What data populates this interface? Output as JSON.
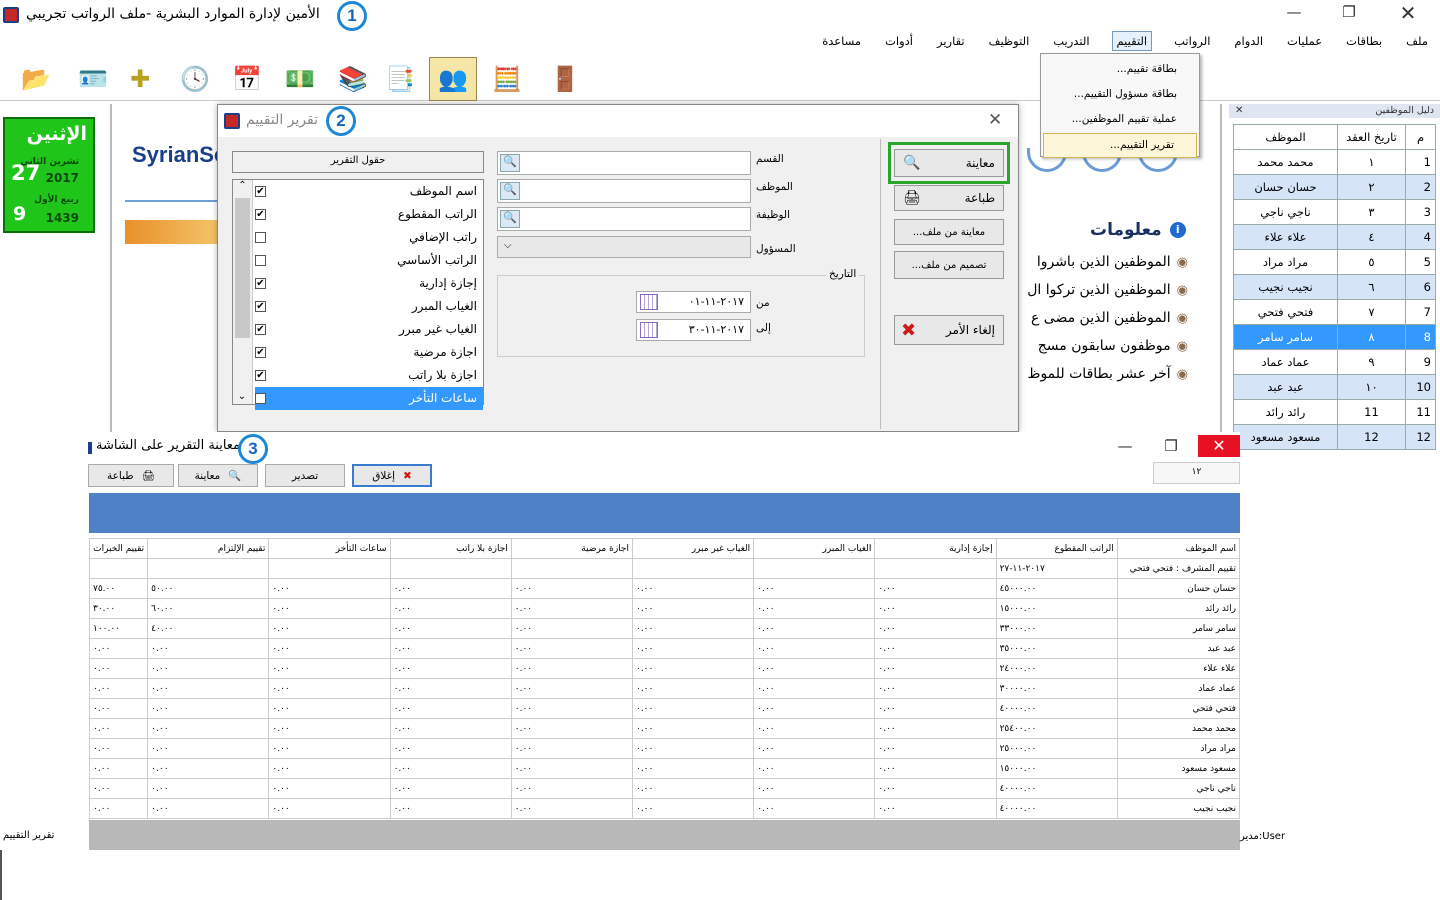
{
  "app": {
    "title": "الأمين لإدارة الموارد البشرية -ملف الرواتب تجريبي",
    "callout": "1"
  },
  "menu": [
    "ملف",
    "بطاقات",
    "عمليات",
    "الدوام",
    "الرواتب",
    "التقييم",
    "التدريب",
    "التوظيف",
    "تقارير",
    "أدوات",
    "مساعدة"
  ],
  "menu_active_index": 5,
  "dropdown": [
    "بطاقة تقييم...",
    "بطاقة مسؤول التقييم...",
    "عملية تقييم الموظفين...",
    "تقرير التقييم..."
  ],
  "date": {
    "day_name": "الإثنين",
    "greg_day": "27",
    "greg_month": "تشرين الثاني",
    "greg_year": "2017",
    "hijri_day": "9",
    "hijri_month": "ربيع الأول",
    "hijri_year": "1439"
  },
  "brand": "SyrianSo",
  "info": {
    "title": "معلومات",
    "items": [
      "الموظفين الذين باشروا",
      "الموظفين الذين تركوا ال",
      "الموظفين الذين مضى ع",
      "موظفون سابقون مسج",
      "آخر عشر بطاقات للموظ"
    ]
  },
  "emp_panel": {
    "title": "دليل الموظفين",
    "headers": [
      "م",
      "تاريخ العقد",
      "الموظف"
    ],
    "rows": [
      [
        "1",
        "١",
        "محمد محمد"
      ],
      [
        "2",
        "٢",
        "حسان حسان"
      ],
      [
        "3",
        "٣",
        "ناجي ناجي"
      ],
      [
        "4",
        "٤",
        "علاء علاء"
      ],
      [
        "5",
        "٥",
        "مراد مراد"
      ],
      [
        "6",
        "٦",
        "نجيب نجيب"
      ],
      [
        "7",
        "٧",
        "فتحي فتحي"
      ],
      [
        "8",
        "٨",
        "سامر سامر"
      ],
      [
        "9",
        "٩",
        "عماد عماد"
      ],
      [
        "10",
        "١٠",
        "عبد عبد"
      ],
      [
        "11",
        "11",
        "رائد رائد"
      ],
      [
        "12",
        "12",
        "مسعود مسعود"
      ]
    ],
    "selected_index": 7
  },
  "dialog": {
    "title": "تقرير التقييم",
    "callout": "2",
    "buttons": {
      "preview": "معاينة",
      "print": "طباعة",
      "preview_file": "معاينة من ملف...",
      "design_file": "تصميم من ملف...",
      "cancel": "إلغاء الأمر"
    },
    "labels": {
      "dept": "القسم",
      "employee": "الموظف",
      "job": "الوظيفة",
      "manager": "المسؤول",
      "date": "التاريخ",
      "from": "من",
      "to": "إلى"
    },
    "from_date": "٢٠١٧-١١-٠١",
    "to_date": "٢٠١٧-١١-٣٠",
    "fields_header": "حقول التقرير",
    "fields": [
      {
        "label": "اسم الموظف",
        "checked": true
      },
      {
        "label": "الراتب المقطوع",
        "checked": true
      },
      {
        "label": "راتب الإضافي",
        "checked": false
      },
      {
        "label": "الراتب الأساسي",
        "checked": false
      },
      {
        "label": "إجازة إدارية",
        "checked": true
      },
      {
        "label": "الغياب المبرر",
        "checked": true
      },
      {
        "label": "الغياب غير مبرر",
        "checked": true
      },
      {
        "label": "اجازة مرضية",
        "checked": true
      },
      {
        "label": "اجازة بلا راتب",
        "checked": true
      },
      {
        "label": "ساعات التأخر",
        "checked": true
      }
    ],
    "selected_field_index": 9
  },
  "preview": {
    "title": "معاينة التقرير على الشاشة",
    "callout": "3",
    "buttons": {
      "close": "إغلاق",
      "export": "تصدير",
      "preview": "معاينة",
      "print": "طباعة"
    },
    "page_field": "١٢",
    "headers": [
      "اسم الموظف",
      "الراتب المقطوع",
      "إجازة إدارية",
      "الغياب المبرر",
      "الغياب غير مبرر",
      "اجازة مرضية",
      "اجازة بلا راتب",
      "ساعات التأخر",
      "تقييم الإلتزام",
      "تقييم الخبرات"
    ],
    "group_label": "تقييم المشرف : فتحي فتحي",
    "group_date": "٢٠١٧-١١-٢٧",
    "rows": [
      [
        "حسان حسان",
        "٤٥٠٠٠.٠٠",
        "٠.٠٠",
        "٠.٠٠",
        "٠.٠٠",
        "٠.٠٠",
        "٠.٠٠",
        "٠.٠٠",
        "٥٠.٠٠",
        "٧٥.٠٠"
      ],
      [
        "رائد رائد",
        "١٥٠٠٠.٠٠",
        "٠.٠٠",
        "٠.٠٠",
        "٠.٠٠",
        "٠.٠٠",
        "٠.٠٠",
        "٠.٠٠",
        "٦٠.٠٠",
        "٣٠.٠٠"
      ],
      [
        "سامر سامر",
        "٣٣٠٠٠.٠٠",
        "٠.٠٠",
        "٠.٠٠",
        "٠.٠٠",
        "٠.٠٠",
        "٠.٠٠",
        "٠.٠٠",
        "٤٠.٠٠",
        "١٠٠.٠٠"
      ],
      [
        "عبد عبد",
        "٣٥٠٠٠.٠٠",
        "٠.٠٠",
        "٠.٠٠",
        "٠.٠٠",
        "٠.٠٠",
        "٠.٠٠",
        "٠.٠٠",
        "٠.٠٠",
        "٠.٠٠"
      ],
      [
        "علاء علاء",
        "٢٤٠٠٠.٠٠",
        "٠.٠٠",
        "٠.٠٠",
        "٠.٠٠",
        "٠.٠٠",
        "٠.٠٠",
        "٠.٠٠",
        "٠.٠٠",
        "٠.٠٠"
      ],
      [
        "عماد عماد",
        "٣٠٠٠٠.٠٠",
        "٠.٠٠",
        "٠.٠٠",
        "٠.٠٠",
        "٠.٠٠",
        "٠.٠٠",
        "٠.٠٠",
        "٠.٠٠",
        "٠.٠٠"
      ],
      [
        "فتحي فتحي",
        "٤٠٠٠٠.٠٠",
        "٠.٠٠",
        "٠.٠٠",
        "٠.٠٠",
        "٠.٠٠",
        "٠.٠٠",
        "٠.٠٠",
        "٠.٠٠",
        "٠.٠٠"
      ],
      [
        "محمد محمد",
        "٢٥٤٠٠.٠٠",
        "٠.٠٠",
        "٠.٠٠",
        "٠.٠٠",
        "٠.٠٠",
        "٠.٠٠",
        "٠.٠٠",
        "٠.٠٠",
        "٠.٠٠"
      ],
      [
        "مراد مراد",
        "٢٥٠٠٠.٠٠",
        "٠.٠٠",
        "٠.٠٠",
        "٠.٠٠",
        "٠.٠٠",
        "٠.٠٠",
        "٠.٠٠",
        "٠.٠٠",
        "٠.٠٠"
      ],
      [
        "مسعود مسعود",
        "١٥٠٠٠.٠٠",
        "٠.٠٠",
        "٠.٠٠",
        "٠.٠٠",
        "٠.٠٠",
        "٠.٠٠",
        "٠.٠٠",
        "٠.٠٠",
        "٠.٠٠"
      ],
      [
        "ناجي ناجي",
        "٤٠٠٠٠.٠٠",
        "٠.٠٠",
        "٠.٠٠",
        "٠.٠٠",
        "٠.٠٠",
        "٠.٠٠",
        "٠.٠٠",
        "٠.٠٠",
        "٠.٠٠"
      ],
      [
        "نجيب نجيب",
        "٤٠٠٠٠.٠٠",
        "٠.٠٠",
        "٠.٠٠",
        "٠.٠٠",
        "٠.٠٠",
        "٠.٠٠",
        "٠.٠٠",
        "٠.٠٠",
        "٠.٠٠"
      ]
    ]
  },
  "status": {
    "left": "تقرير التقييم",
    "right": "مدير:User"
  },
  "colors": {
    "accent_blue": "#4f81c7",
    "selected": "#3399ff",
    "green_border": "#2aa52a",
    "date_bg": "#20c51a",
    "callout": "#1e88d6"
  }
}
